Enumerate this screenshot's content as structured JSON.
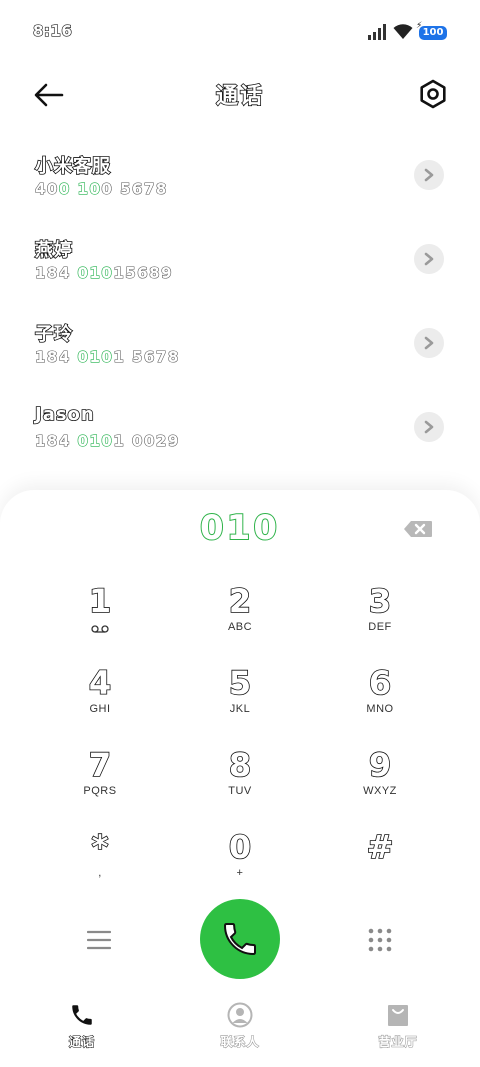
{
  "status_bar": {
    "time": "8:16",
    "battery": "100"
  },
  "header": {
    "title": "通话"
  },
  "contacts": [
    {
      "name": "小米客服",
      "number": [
        {
          "t": "40",
          "h": false
        },
        {
          "t": "0",
          "h": true
        },
        {
          "t": " ",
          "h": false
        },
        {
          "t": "10",
          "h": true
        },
        {
          "t": "0 5678",
          "h": false
        }
      ]
    },
    {
      "name": "燕婷",
      "number": [
        {
          "t": "184 ",
          "h": false
        },
        {
          "t": "010",
          "h": true
        },
        {
          "t": "15689",
          "h": false
        }
      ]
    },
    {
      "name": "子玲",
      "number": [
        {
          "t": "184 ",
          "h": false
        },
        {
          "t": "010",
          "h": true
        },
        {
          "t": "1 5678",
          "h": false
        }
      ]
    },
    {
      "name": "Jason",
      "number": [
        {
          "t": "184 ",
          "h": false
        },
        {
          "t": "010",
          "h": true
        },
        {
          "t": "1 0029",
          "h": false
        }
      ]
    }
  ],
  "dialer": {
    "entered": "010",
    "keys": [
      {
        "digit": "1",
        "sub": ""
      },
      {
        "digit": "2",
        "sub": "ABC"
      },
      {
        "digit": "3",
        "sub": "DEF"
      },
      {
        "digit": "4",
        "sub": "GHI"
      },
      {
        "digit": "5",
        "sub": "JKL"
      },
      {
        "digit": "6",
        "sub": "MNO"
      },
      {
        "digit": "7",
        "sub": "PQRS"
      },
      {
        "digit": "8",
        "sub": "TUV"
      },
      {
        "digit": "9",
        "sub": "WXYZ"
      },
      {
        "digit": "*",
        "sub": ","
      },
      {
        "digit": "0",
        "sub": "+"
      },
      {
        "digit": "#",
        "sub": ""
      }
    ]
  },
  "bottom_nav": [
    {
      "label": "通话",
      "icon": "phone-icon",
      "active": true
    },
    {
      "label": "联系人",
      "icon": "person-icon",
      "active": false
    },
    {
      "label": "营业厅",
      "icon": "bag-icon",
      "active": false
    }
  ],
  "colors": {
    "accent": "#2ec043",
    "highlight": "#22b14c",
    "battery": "#1e73e8"
  }
}
